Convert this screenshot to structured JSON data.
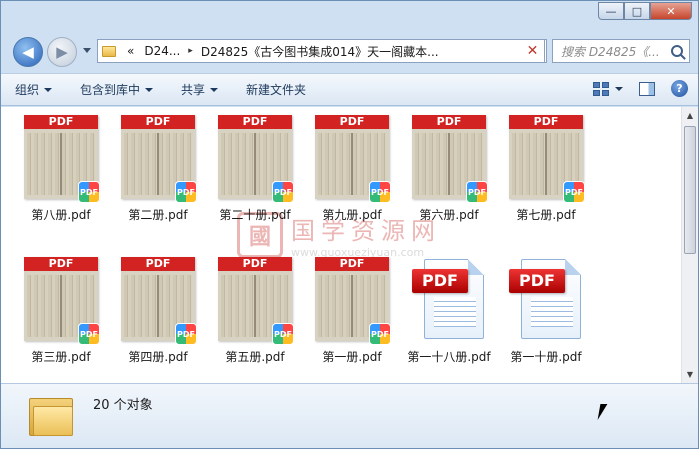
{
  "window": {
    "minimize": "—",
    "maximize": "□",
    "close": "✕"
  },
  "address": {
    "chevron": "«",
    "crumbs": [
      "D24...",
      "D24825《古今图书集成014》天一阁藏本..."
    ],
    "sep": "▸",
    "dropdown": "▼",
    "clear": "✕"
  },
  "search": {
    "placeholder": "搜索 D24825《..."
  },
  "toolbar": {
    "organize": "组织",
    "include_library": "包含到库中",
    "share": "共享",
    "new_folder": "新建文件夹"
  },
  "files": [
    {
      "name": "第八册.pdf",
      "kind": "scan"
    },
    {
      "name": "第二册.pdf",
      "kind": "scan"
    },
    {
      "name": "第二十册.pdf",
      "kind": "scan"
    },
    {
      "name": "第九册.pdf",
      "kind": "scan"
    },
    {
      "name": "第六册.pdf",
      "kind": "scan"
    },
    {
      "name": "第七册.pdf",
      "kind": "scan"
    },
    {
      "name": "第三册.pdf",
      "kind": "scan"
    },
    {
      "name": "第四册.pdf",
      "kind": "scan"
    },
    {
      "name": "第五册.pdf",
      "kind": "scan"
    },
    {
      "name": "第一册.pdf",
      "kind": "scan"
    },
    {
      "name": "第一十八册.pdf",
      "kind": "doc"
    },
    {
      "name": "第一十册.pdf",
      "kind": "doc"
    }
  ],
  "thumb_label": "PDF",
  "badge_label": "PDF",
  "watermark": {
    "seal": "國",
    "title": "国学资源网",
    "url": "www.guoxueziyuan.com"
  },
  "status": {
    "count": "20 个对象"
  },
  "colors": {
    "pdf_red": "#d32222",
    "accent": "#1e395b"
  }
}
